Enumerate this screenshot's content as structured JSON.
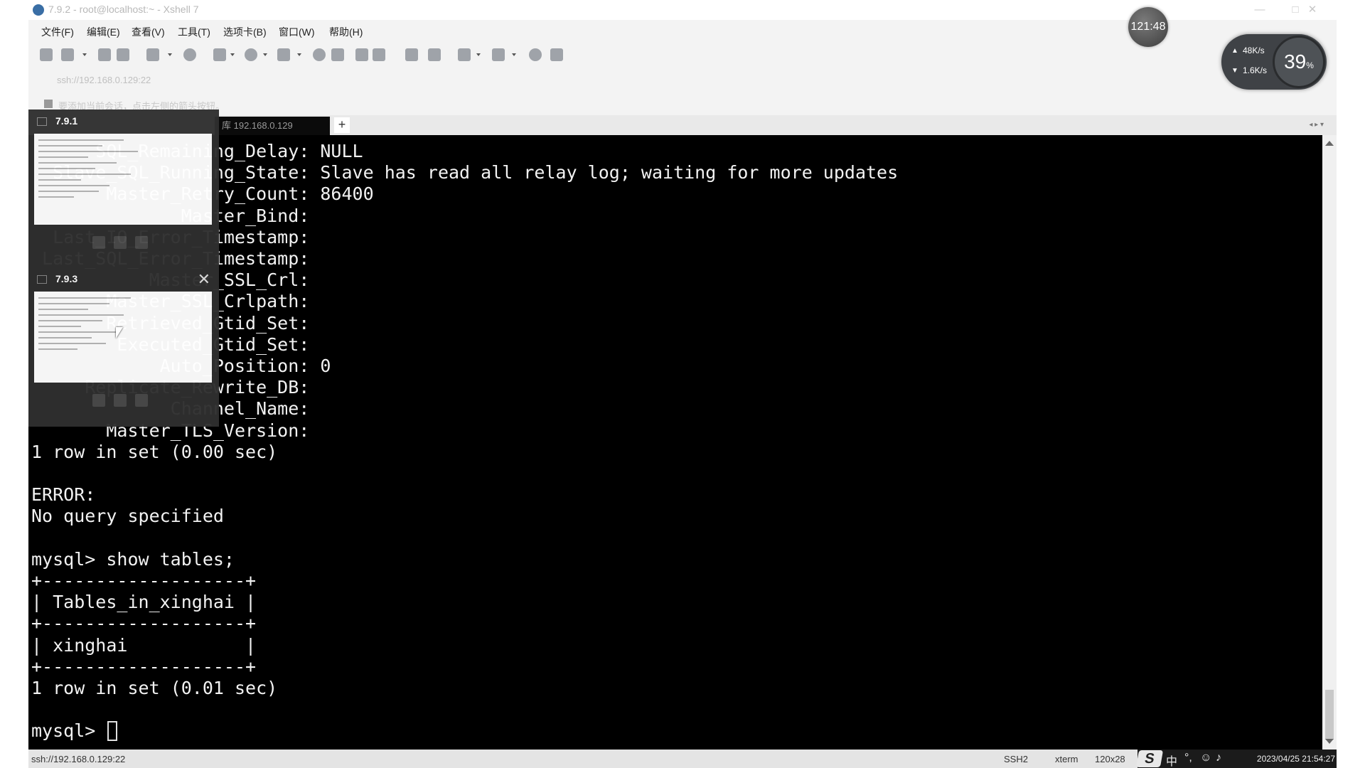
{
  "window": {
    "title": "7.9.2 - root@localhost:~ - Xshell 7",
    "controls": {
      "minimize": "—",
      "maximize": "□",
      "close": "✕"
    }
  },
  "menu": [
    "文件(F)",
    "编辑(E)",
    "查看(V)",
    "工具(T)",
    "选项卡(B)",
    "窗口(W)",
    "帮助(H)"
  ],
  "address": {
    "value": "ssh://192.168.0.129:22"
  },
  "hint": {
    "text": "要添加当前会话，点击左侧的箭头按钮。"
  },
  "tabs": {
    "active_label": "库 192.168.0.129",
    "add_label": "+"
  },
  "terminal": {
    "lines": [
      "      SQL_Remaining_Delay: NULL",
      "  Slave_SQL_Running_State: Slave has read all relay log; waiting for more updates",
      "       Master_Retry_Count: 86400",
      "              Master_Bind:",
      "  Last_IO_Error_Timestamp:",
      " Last_SQL_Error_Timestamp:",
      "           Master_SSL_Crl:",
      "       Master_SSL_Crlpath:",
      "       Retrieved_Gtid_Set:",
      "        Executed_Gtid_Set:",
      "            Auto_Position: 0",
      "     Replicate_Rewrite_DB:",
      "             Channel_Name:",
      "       Master_TLS_Version:",
      "1 row in set (0.00 sec)",
      "",
      "ERROR:",
      "No query specified",
      "",
      "mysql> show tables;",
      "+-------------------+",
      "| Tables_in_xinghai |",
      "+-------------------+",
      "| xinghai           |",
      "+-------------------+",
      "1 row in set (0.01 sec)",
      ""
    ],
    "prompt": "mysql> "
  },
  "status": {
    "path": "ssh://192.168.0.129:22",
    "protocol": "SSH2",
    "term_type": "xterm",
    "size": "120x28"
  },
  "tray": {
    "ime_badge": "S",
    "ime_lang": "中",
    "clock": "2023/04/25 21:54:27"
  },
  "previews": [
    {
      "title": "7.9.1"
    },
    {
      "title": "7.9.3",
      "close": "✕"
    }
  ],
  "overlay": {
    "clock_badge": "121:48",
    "upload_rate": "48K/s",
    "download_rate": "1.6K/s",
    "gauge_value": "39",
    "gauge_unit": "%"
  }
}
